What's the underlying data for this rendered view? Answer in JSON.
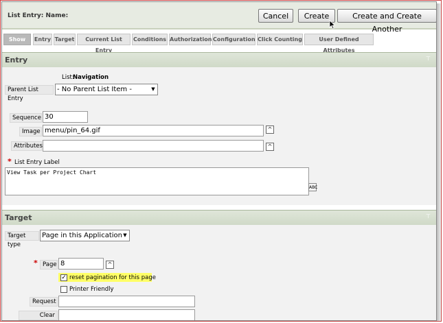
{
  "header": {
    "label": "List Entry:  Name:",
    "buttons": {
      "cancel": "Cancel",
      "create": "Create",
      "create_another": "Create and Create Another"
    }
  },
  "tabs": [
    "Show All",
    "Entry",
    "Target",
    "Current List Entry",
    "Conditions",
    "Authorization",
    "Configuration",
    "Click Counting",
    "User Defined Attributes"
  ],
  "entry": {
    "title": "Entry",
    "top_icon": "⊤",
    "list_label": "List:",
    "list_value": "Navigation",
    "parent_label": "Parent List Entry",
    "parent_value": "- No Parent List Item -",
    "sequence_label": "Sequence",
    "sequence_value": "30",
    "image_label": "Image",
    "image_value": "menu/pin_64.gif",
    "attributes_label": "Attributes",
    "attributes_value": "",
    "entry_label_label": "List Entry Label",
    "entry_label_value": "View Task per Project Chart",
    "required_marker": "*",
    "spell_icon_text": "ABC"
  },
  "target": {
    "title": "Target",
    "top_icon": "⊤",
    "type_label": "Target type",
    "type_value": "Page in this Application",
    "page_label": "Page",
    "page_value": "8",
    "reset_label": "reset pagination for this page",
    "reset_checked": true,
    "printer_label": "Printer Friendly",
    "printer_checked": false,
    "request_label": "Request",
    "request_value": "",
    "clear_cache_label": "Clear Cache",
    "clear_cache_value": ""
  },
  "icons": {
    "expand": "up-arrow-expand-icon",
    "spell": "spellcheck-icon",
    "cursor": "mouse-pointer-icon"
  },
  "colors": {
    "section_bar": "#cfd9c7",
    "highlight": "#ffff66",
    "required": "#cc0000"
  }
}
